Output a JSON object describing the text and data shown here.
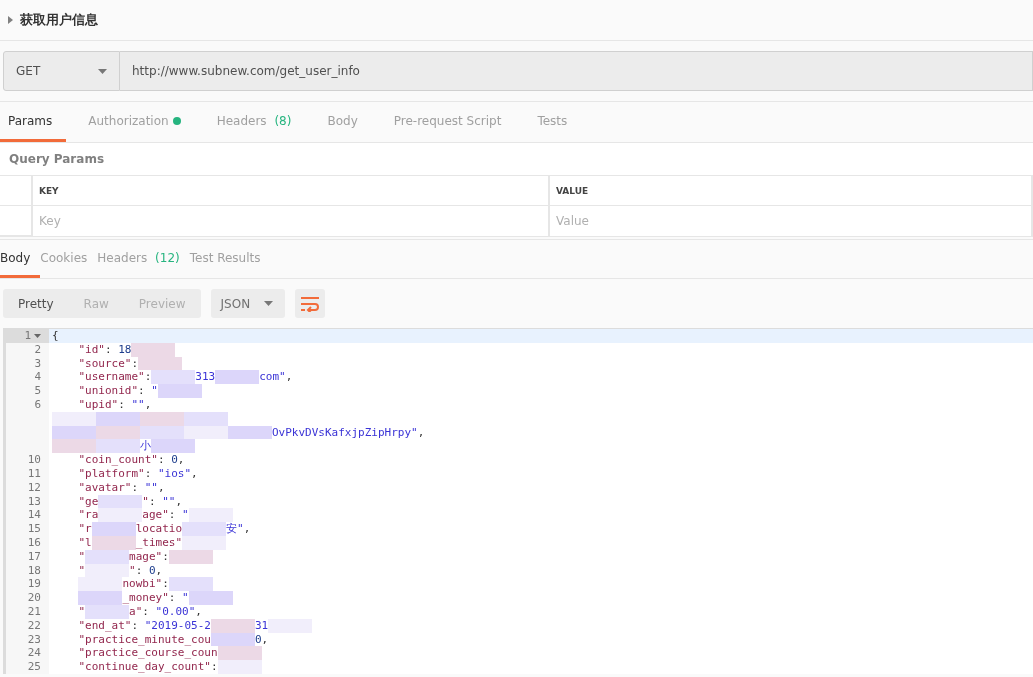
{
  "request": {
    "title": "获取用户信息",
    "method": "GET",
    "url": "http://www.subnew.com/get_user_info"
  },
  "request_tabs": [
    {
      "label": "Params",
      "dot": false,
      "selected": true
    },
    {
      "label": "Authorization",
      "dot": true,
      "selected": false
    },
    {
      "label": "Headers",
      "count": "(8)",
      "dot": false,
      "selected": false
    },
    {
      "label": "Body",
      "dot": false,
      "selected": false
    },
    {
      "label": "Pre-request Script",
      "dot": false,
      "selected": false
    },
    {
      "label": "Tests",
      "dot": false,
      "selected": false
    }
  ],
  "query_params": {
    "title": "Query Params",
    "columns": [
      "KEY",
      "VALUE"
    ],
    "placeholders": [
      "Key",
      "Value"
    ]
  },
  "response_tabs": [
    {
      "label": "Body",
      "selected": true
    },
    {
      "label": "Cookies",
      "selected": false
    },
    {
      "label": "Headers",
      "count": "(12)",
      "selected": false
    },
    {
      "label": "Test Results",
      "selected": false
    }
  ],
  "view_modes": [
    {
      "label": "Pretty",
      "selected": true
    },
    {
      "label": "Raw",
      "selected": false
    },
    {
      "label": "Preview",
      "selected": false
    }
  ],
  "format": "JSON",
  "code_lines": [
    {
      "num": "1",
      "fold": true,
      "active": true,
      "indent": false,
      "parts": [
        {
          "kind": "plain",
          "text": "{"
        }
      ]
    },
    {
      "num": "2",
      "active": false,
      "indent": true,
      "parts": [
        {
          "kind": "key",
          "text": "\"id\""
        },
        {
          "kind": "plain",
          "text": ": "
        },
        {
          "kind": "number",
          "text": "18"
        },
        {
          "kind": "redacted"
        }
      ]
    },
    {
      "num": "3",
      "active": false,
      "indent": true,
      "parts": [
        {
          "kind": "key",
          "text": "\"source\""
        },
        {
          "kind": "plain",
          "text": ":"
        },
        {
          "kind": "redacted"
        }
      ]
    },
    {
      "num": "4",
      "active": false,
      "indent": true,
      "parts": [
        {
          "kind": "key",
          "text": "\"username\""
        },
        {
          "kind": "plain",
          "text": ":"
        },
        {
          "kind": "redacted"
        },
        {
          "kind": "string",
          "text": "313"
        },
        {
          "kind": "redacted"
        },
        {
          "kind": "string",
          "text": "com\""
        },
        {
          "kind": "plain",
          "text": ","
        }
      ]
    },
    {
      "num": "5",
      "active": false,
      "indent": true,
      "parts": [
        {
          "kind": "key",
          "text": "\"unionid\""
        },
        {
          "kind": "plain",
          "text": ": "
        },
        {
          "kind": "string",
          "text": "\""
        },
        {
          "kind": "redacted"
        }
      ]
    },
    {
      "num": "6",
      "active": false,
      "indent": true,
      "parts": [
        {
          "kind": "key",
          "text": "\"upid\""
        },
        {
          "kind": "plain",
          "text": ": "
        },
        {
          "kind": "string",
          "text": "\"\""
        },
        {
          "kind": "plain",
          "text": ","
        }
      ]
    },
    {
      "active": false,
      "indent": false,
      "parts": [
        {
          "kind": "redacted"
        },
        {
          "kind": "redacted"
        },
        {
          "kind": "redacted"
        },
        {
          "kind": "redacted"
        }
      ]
    },
    {
      "active": false,
      "indent": false,
      "parts": [
        {
          "kind": "redacted"
        },
        {
          "kind": "redacted"
        },
        {
          "kind": "redacted"
        },
        {
          "kind": "redacted"
        },
        {
          "kind": "redacted"
        },
        {
          "kind": "string",
          "text": "OvPkvDVsKafxjpZipHrpy\""
        },
        {
          "kind": "plain",
          "text": ","
        }
      ]
    },
    {
      "active": false,
      "indent": false,
      "parts": [
        {
          "kind": "redacted"
        },
        {
          "kind": "redacted"
        },
        {
          "kind": "string",
          "text": "小"
        },
        {
          "kind": "redacted"
        }
      ]
    },
    {
      "num": "10",
      "active": false,
      "indent": true,
      "parts": [
        {
          "kind": "key",
          "text": "\"coin_count\""
        },
        {
          "kind": "plain",
          "text": ": "
        },
        {
          "kind": "number",
          "text": "0"
        },
        {
          "kind": "plain",
          "text": ","
        }
      ]
    },
    {
      "num": "11",
      "active": false,
      "indent": true,
      "parts": [
        {
          "kind": "key",
          "text": "\"platform\""
        },
        {
          "kind": "plain",
          "text": ": "
        },
        {
          "kind": "string",
          "text": "\"ios\""
        },
        {
          "kind": "plain",
          "text": ","
        }
      ]
    },
    {
      "num": "12",
      "active": false,
      "indent": true,
      "parts": [
        {
          "kind": "key",
          "text": "\"avatar\""
        },
        {
          "kind": "plain",
          "text": ": "
        },
        {
          "kind": "string",
          "text": "\"\""
        },
        {
          "kind": "plain",
          "text": ","
        }
      ]
    },
    {
      "num": "13",
      "active": false,
      "indent": true,
      "parts": [
        {
          "kind": "key",
          "text": "\"ge"
        },
        {
          "kind": "redacted"
        },
        {
          "kind": "key",
          "text": "\""
        },
        {
          "kind": "plain",
          "text": ": "
        },
        {
          "kind": "string",
          "text": "\"\""
        },
        {
          "kind": "plain",
          "text": ","
        }
      ]
    },
    {
      "num": "14",
      "active": false,
      "indent": true,
      "parts": [
        {
          "kind": "key",
          "text": "\"ra"
        },
        {
          "kind": "redacted"
        },
        {
          "kind": "key",
          "text": "age\""
        },
        {
          "kind": "plain",
          "text": ": "
        },
        {
          "kind": "string",
          "text": "\""
        },
        {
          "kind": "redacted"
        }
      ]
    },
    {
      "num": "15",
      "active": false,
      "indent": true,
      "parts": [
        {
          "kind": "key",
          "text": "\"r"
        },
        {
          "kind": "redacted"
        },
        {
          "kind": "key",
          "text": "locatio"
        },
        {
          "kind": "redacted"
        },
        {
          "kind": "string",
          "text": "安\""
        },
        {
          "kind": "plain",
          "text": ","
        }
      ]
    },
    {
      "num": "16",
      "active": false,
      "indent": true,
      "parts": [
        {
          "kind": "key",
          "text": "\"l"
        },
        {
          "kind": "redacted"
        },
        {
          "kind": "key",
          "text": "_times\""
        },
        {
          "kind": "redacted"
        }
      ]
    },
    {
      "num": "17",
      "active": false,
      "indent": true,
      "parts": [
        {
          "kind": "key",
          "text": "\""
        },
        {
          "kind": "redacted"
        },
        {
          "kind": "key",
          "text": "mage\""
        },
        {
          "kind": "plain",
          "text": ":"
        },
        {
          "kind": "redacted"
        }
      ]
    },
    {
      "num": "18",
      "active": false,
      "indent": true,
      "parts": [
        {
          "kind": "key",
          "text": "\""
        },
        {
          "kind": "redacted"
        },
        {
          "kind": "key",
          "text": "\""
        },
        {
          "kind": "plain",
          "text": ": "
        },
        {
          "kind": "number",
          "text": "0"
        },
        {
          "kind": "plain",
          "text": ","
        }
      ]
    },
    {
      "num": "19",
      "active": false,
      "indent": true,
      "parts": [
        {
          "kind": "redacted"
        },
        {
          "kind": "key",
          "text": "nowbi\""
        },
        {
          "kind": "plain",
          "text": ":"
        },
        {
          "kind": "redacted"
        }
      ]
    },
    {
      "num": "20",
      "active": false,
      "indent": true,
      "parts": [
        {
          "kind": "redacted"
        },
        {
          "kind": "key",
          "text": "_money\""
        },
        {
          "kind": "plain",
          "text": ": "
        },
        {
          "kind": "string",
          "text": "\""
        },
        {
          "kind": "redacted"
        }
      ]
    },
    {
      "num": "21",
      "active": false,
      "indent": true,
      "parts": [
        {
          "kind": "key",
          "text": "\""
        },
        {
          "kind": "redacted"
        },
        {
          "kind": "key",
          "text": "a\""
        },
        {
          "kind": "plain",
          "text": ": "
        },
        {
          "kind": "string",
          "text": "\"0.00\""
        },
        {
          "kind": "plain",
          "text": ","
        }
      ]
    },
    {
      "num": "22",
      "active": false,
      "indent": true,
      "parts": [
        {
          "kind": "key",
          "text": "\"end_at\""
        },
        {
          "kind": "plain",
          "text": ": "
        },
        {
          "kind": "string",
          "text": "\"2019-05-2"
        },
        {
          "kind": "redacted"
        },
        {
          "kind": "string",
          "text": "31"
        },
        {
          "kind": "redacted"
        }
      ]
    },
    {
      "num": "23",
      "active": false,
      "indent": true,
      "parts": [
        {
          "kind": "key",
          "text": "\"practice_minute_cou"
        },
        {
          "kind": "redacted"
        },
        {
          "kind": "number",
          "text": "0"
        },
        {
          "kind": "plain",
          "text": ","
        }
      ]
    },
    {
      "num": "24",
      "active": false,
      "indent": true,
      "parts": [
        {
          "kind": "key",
          "text": "\"practice_course_coun"
        },
        {
          "kind": "redacted"
        }
      ]
    },
    {
      "num": "25",
      "active": false,
      "indent": true,
      "parts": [
        {
          "kind": "key",
          "text": "\"continue_day_count\""
        },
        {
          "kind": "plain",
          "text": ":"
        },
        {
          "kind": "redacted"
        }
      ]
    }
  ]
}
